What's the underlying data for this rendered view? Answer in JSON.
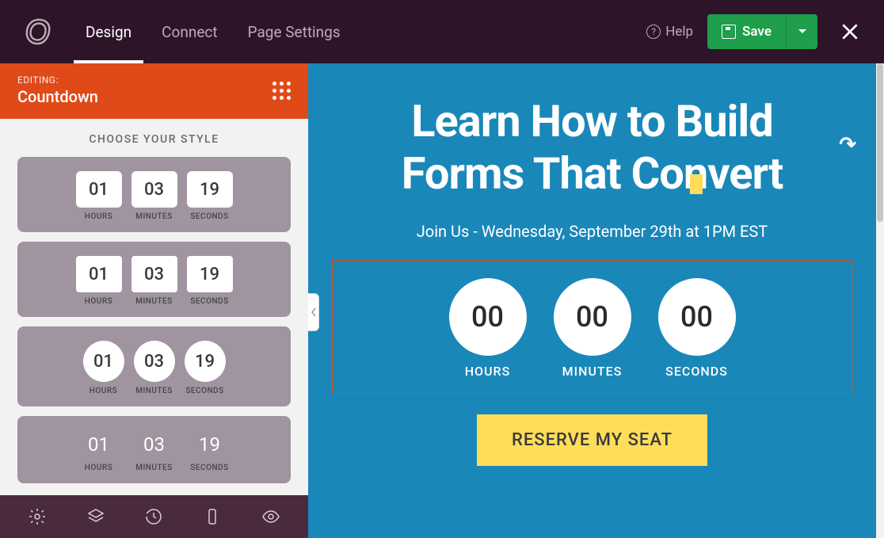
{
  "topbar": {
    "tabs": [
      "Design",
      "Connect",
      "Page Settings"
    ],
    "active_tab": 0,
    "help_label": "Help",
    "save_label": "Save"
  },
  "sidebar": {
    "editing_label": "EDITING:",
    "element_name": "Countdown",
    "styles_title": "CHOOSE YOUR STYLE",
    "style_options": [
      {
        "shape": "rounded",
        "units": [
          {
            "v": "01",
            "l": "HOURS"
          },
          {
            "v": "03",
            "l": "MINUTES"
          },
          {
            "v": "19",
            "l": "SECONDS"
          }
        ]
      },
      {
        "shape": "square",
        "units": [
          {
            "v": "01",
            "l": "HOURS"
          },
          {
            "v": "03",
            "l": "MINUTES"
          },
          {
            "v": "19",
            "l": "SECONDS"
          }
        ]
      },
      {
        "shape": "circle",
        "units": [
          {
            "v": "01",
            "l": "HOURS"
          },
          {
            "v": "03",
            "l": "MINUTES"
          },
          {
            "v": "19",
            "l": "SECONDS"
          }
        ]
      },
      {
        "shape": "none",
        "units": [
          {
            "v": "01",
            "l": "HOURS"
          },
          {
            "v": "03",
            "l": "MINUTES"
          },
          {
            "v": "19",
            "l": "SECONDS"
          }
        ]
      }
    ]
  },
  "canvas": {
    "headline_l1": "Learn How to Build",
    "headline_l2": "Forms That Convert",
    "subhead": "Join Us - Wednesday, September 29th at 1PM EST",
    "countdown": [
      {
        "v": "00",
        "l": "HOURS"
      },
      {
        "v": "00",
        "l": "MINUTES"
      },
      {
        "v": "00",
        "l": "SECONDS"
      }
    ],
    "cta_label": "RESERVE MY SEAT"
  },
  "colors": {
    "accent": "#e04a19",
    "save": "#1f9e4b",
    "canvas_bg": "#1a87b9",
    "cta_bg": "#fedd59"
  }
}
